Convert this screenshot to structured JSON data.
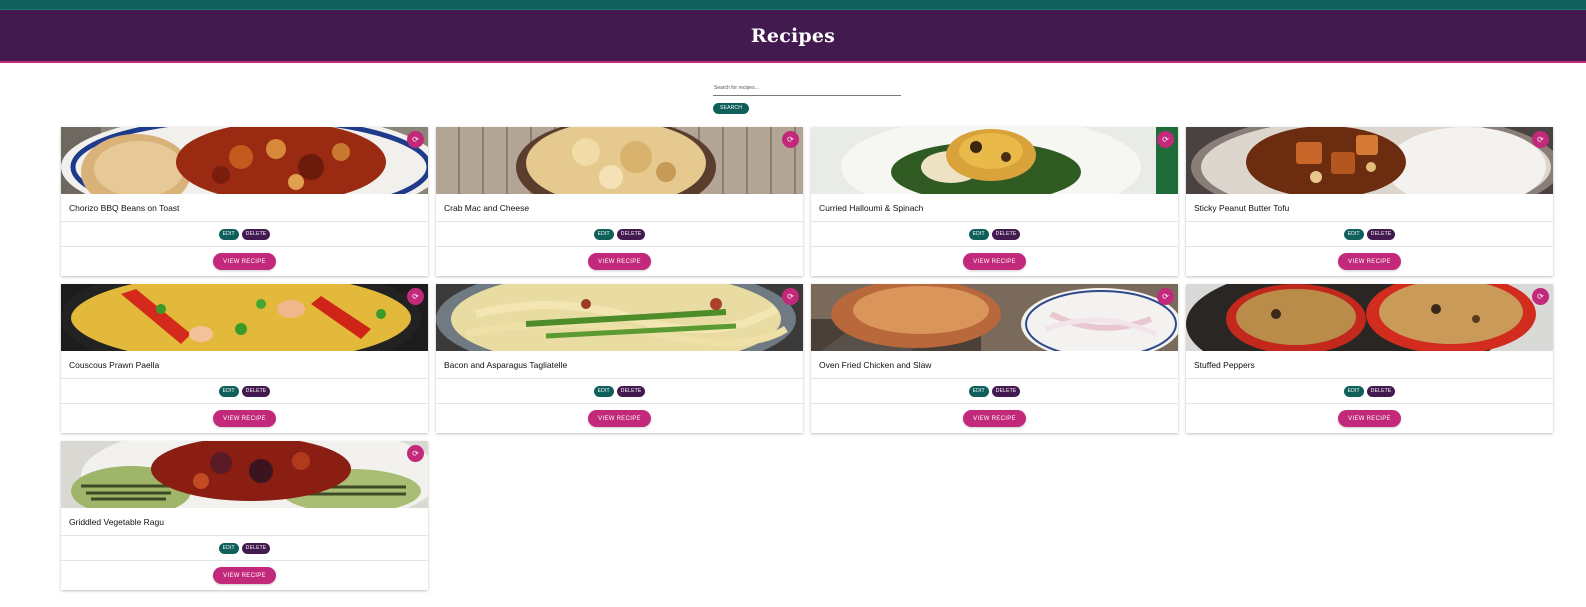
{
  "header": {
    "title": "Recipes"
  },
  "search": {
    "placeholder": "Search for recipes...",
    "button_label": "SEARCH"
  },
  "card_labels": {
    "edit": "EDIT",
    "delete": "DELETE",
    "view": "VIEW RECIPE",
    "favorite_icon": "refresh-icon"
  },
  "recipes": [
    {
      "title": "Chorizo BBQ Beans on Toast",
      "image": "chorizo-beans-toast"
    },
    {
      "title": "Crab Mac and Cheese",
      "image": "crab-mac-cheese"
    },
    {
      "title": "Curried Halloumi & Spinach",
      "image": "curried-halloumi-spinach"
    },
    {
      "title": "Sticky Peanut Butter Tofu",
      "image": "sticky-tofu-rice"
    },
    {
      "title": "Couscous Prawn Paella",
      "image": "couscous-paella"
    },
    {
      "title": "Bacon and Asparagus Tagliatelle",
      "image": "tagliatelle-asparagus"
    },
    {
      "title": "Oven Fried Chicken and Slaw",
      "image": "fried-chicken-slaw"
    },
    {
      "title": "Stuffed Peppers",
      "image": "stuffed-peppers"
    },
    {
      "title": "Griddled Vegetable Ragu",
      "image": "griddled-vegetable-ragu"
    }
  ],
  "colors": {
    "teal": "#0f5f5b",
    "purple": "#431a50",
    "magenta": "#c2297a"
  }
}
